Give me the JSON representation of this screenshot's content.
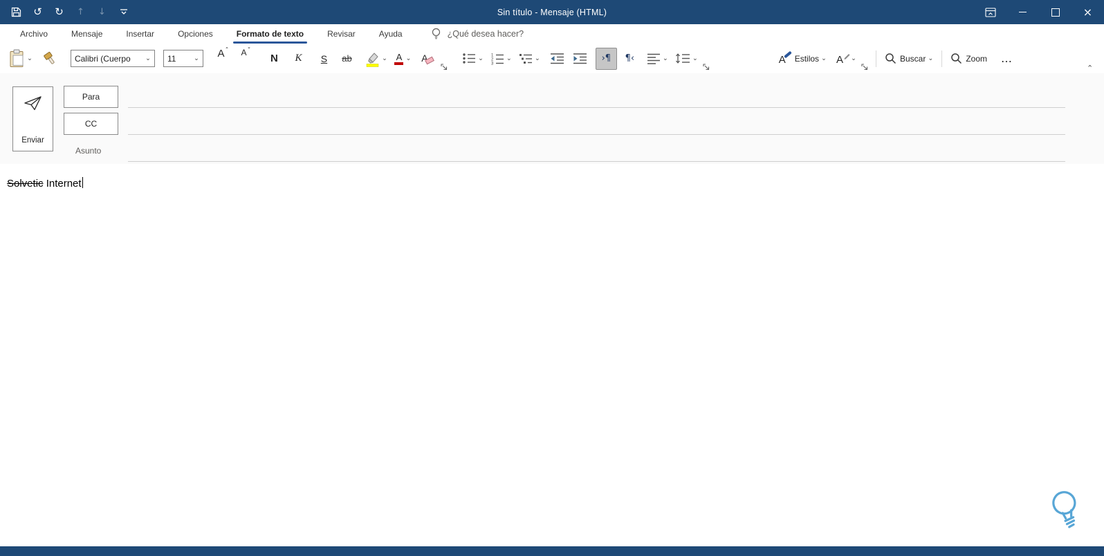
{
  "window": {
    "title": "Sin título  -  Mensaje (HTML)"
  },
  "colors": {
    "titlebar": "#1e4976",
    "accent": "#2b579a",
    "highlight_yellow": "#ffff00",
    "font_color_red": "#c00000"
  },
  "icons": {
    "undo": "↺",
    "redo": "↻",
    "move_up": "↑",
    "move_down": "↓",
    "chevron_down": "⌄",
    "close": "×",
    "more": "…",
    "letter_a": "A",
    "caret_grow": "ˆ",
    "caret_shrink": "ˇ",
    "bold": "N",
    "italic": "K",
    "underline": "S",
    "strikethrough": "ab",
    "ltr_paragraph": "›¶",
    "rtl_paragraph": "¶‹",
    "num1": "1",
    "num2": "2",
    "num3": "3"
  },
  "tabs": [
    {
      "label": "Archivo"
    },
    {
      "label": "Mensaje"
    },
    {
      "label": "Insertar"
    },
    {
      "label": "Opciones"
    },
    {
      "label": "Formato de texto"
    },
    {
      "label": "Revisar"
    },
    {
      "label": "Ayuda"
    }
  ],
  "tellme": {
    "label": "¿Qué desea hacer?"
  },
  "ribbon": {
    "font_name": "Calibri (Cuerpo",
    "font_size": "11",
    "styles_label": "Estilos",
    "search_label": "Buscar",
    "zoom_label": "Zoom"
  },
  "compose": {
    "send_label": "Enviar",
    "to_label": "Para",
    "cc_label": "CC",
    "subject_label": "Asunto"
  },
  "editor": {
    "strikethrough_text": "Solvetic",
    "normal_text": " Internet"
  }
}
